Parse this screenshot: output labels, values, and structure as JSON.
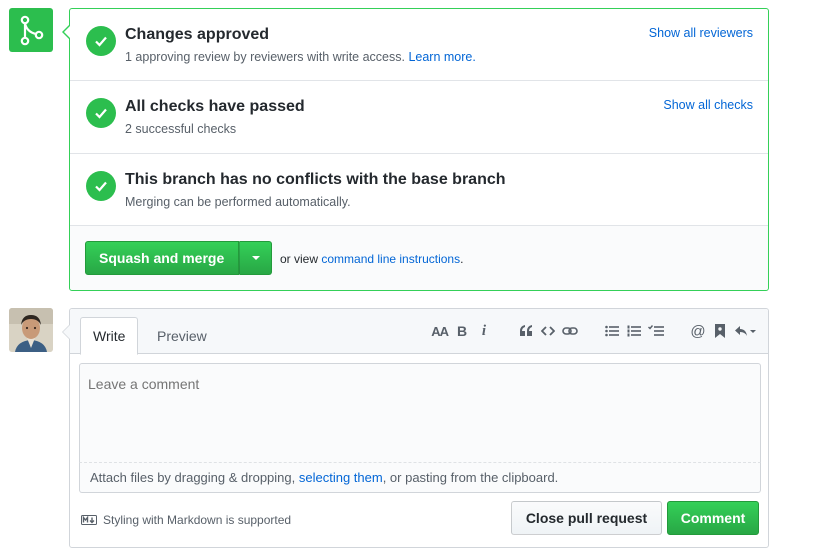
{
  "merge": {
    "checks": [
      {
        "title": "Changes approved",
        "desc": "1 approving review by reviewers with write access.",
        "desc_link": "Learn more.",
        "right_link": "Show all reviewers"
      },
      {
        "title": "All checks have passed",
        "desc": "2 successful checks",
        "right_link": "Show all checks"
      },
      {
        "title": "This branch has no conflicts with the base branch",
        "desc": "Merging can be performed automatically."
      }
    ],
    "button_label": "Squash and merge",
    "alt_prefix": "or view",
    "alt_link": "command line instructions",
    "alt_suffix": "."
  },
  "comment": {
    "tabs": [
      "Write",
      "Preview"
    ],
    "placeholder": "Leave a comment",
    "attach_prefix": "Attach files by dragging & dropping,",
    "attach_link": "selecting them",
    "attach_suffix": ", or pasting from the clipboard.",
    "markdown_note": "Styling with Markdown is supported",
    "close_label": "Close pull request",
    "comment_label": "Comment"
  },
  "toolbar": {
    "heading": "AA",
    "bold": "B",
    "italic": "i"
  },
  "colors": {
    "success": "#2cbe4e",
    "link": "#0366d6",
    "border_success": "#34d058"
  }
}
